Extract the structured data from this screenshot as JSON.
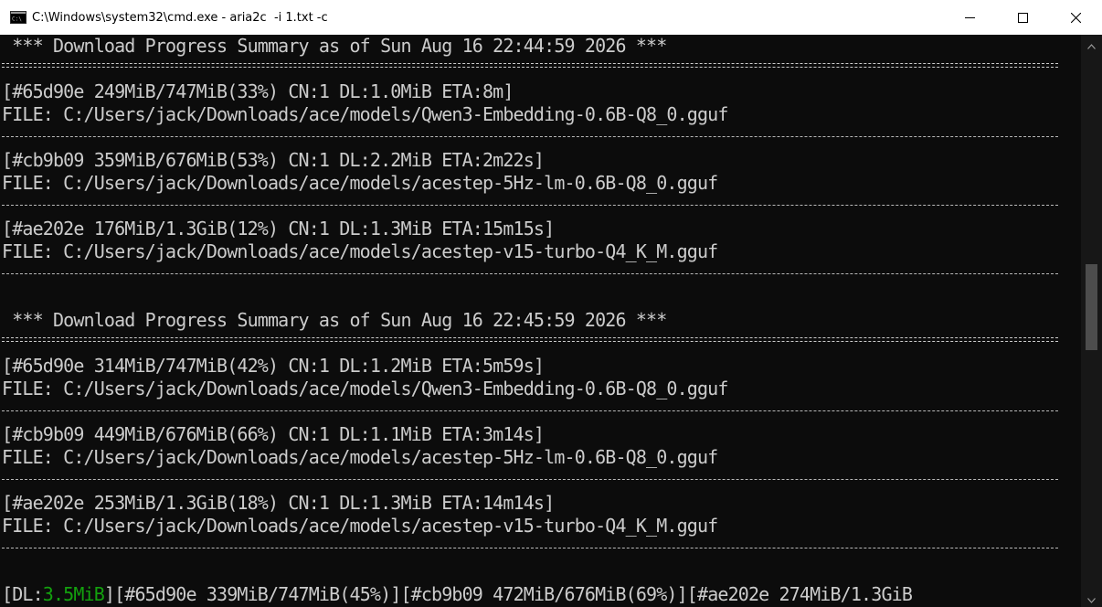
{
  "window": {
    "title": "C:\\Windows\\system32\\cmd.exe - aria2c  -i 1.txt -c",
    "icon": "cmd-icon",
    "controls": [
      "minimize-icon",
      "maximize-icon",
      "close-icon"
    ]
  },
  "console": {
    "summaries": [
      {
        "header": " *** Download Progress Summary as of Sun Aug 16 22:44:59 2026 ***",
        "items": [
          {
            "status": "[#65d90e 249MiB/747MiB(33%) CN:1 DL:1.0MiB ETA:8m]",
            "file": "FILE: C:/Users/jack/Downloads/ace/models/Qwen3-Embedding-0.6B-Q8_0.gguf"
          },
          {
            "status": "[#cb9b09 359MiB/676MiB(53%) CN:1 DL:2.2MiB ETA:2m22s]",
            "file": "FILE: C:/Users/jack/Downloads/ace/models/acestep-5Hz-lm-0.6B-Q8_0.gguf"
          },
          {
            "status": "[#ae202e 176MiB/1.3GiB(12%) CN:1 DL:1.3MiB ETA:15m15s]",
            "file": "FILE: C:/Users/jack/Downloads/ace/models/acestep-v15-turbo-Q4_K_M.gguf"
          }
        ]
      },
      {
        "header": " *** Download Progress Summary as of Sun Aug 16 22:45:59 2026 ***",
        "items": [
          {
            "status": "[#65d90e 314MiB/747MiB(42%) CN:1 DL:1.2MiB ETA:5m59s]",
            "file": "FILE: C:/Users/jack/Downloads/ace/models/Qwen3-Embedding-0.6B-Q8_0.gguf"
          },
          {
            "status": "[#cb9b09 449MiB/676MiB(66%) CN:1 DL:1.1MiB ETA:3m14s]",
            "file": "FILE: C:/Users/jack/Downloads/ace/models/acestep-5Hz-lm-0.6B-Q8_0.gguf"
          },
          {
            "status": "[#ae202e 253MiB/1.3GiB(18%) CN:1 DL:1.3MiB ETA:14m14s]",
            "file": "FILE: C:/Users/jack/Downloads/ace/models/acestep-v15-turbo-Q4_K_M.gguf"
          }
        ]
      }
    ],
    "status_line": {
      "prefix": "[DL:",
      "speed": "3.5MiB",
      "rest": "][#65d90e 339MiB/747MiB(45%)][#cb9b09 472MiB/676MiB(69%)][#ae202e 274MiB/1.3GiB"
    }
  },
  "scrollbar": {
    "up_icon": "scroll-up-icon",
    "down_icon": "scroll-down-icon"
  },
  "colors": {
    "background": "#0c0c0c",
    "text": "#cccccc",
    "speed": "#13a10e",
    "titlebar": "#ffffff"
  }
}
